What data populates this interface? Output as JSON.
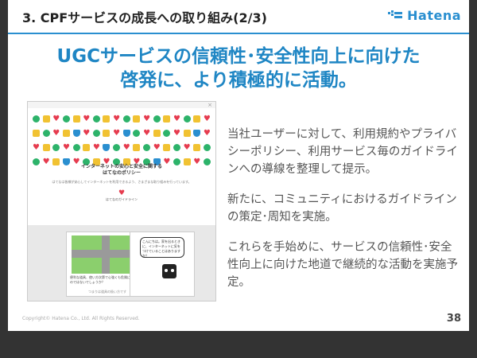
{
  "header": {
    "title": "3. CPFサービスの成長への取り組み(2/3)",
    "logo_text": "Hatena"
  },
  "heading": {
    "line1": "UGCサービスの信頼性･安全性向上に向けた",
    "line2": "啓発に、より積極的に活動。"
  },
  "preview": {
    "close_glyph": "×",
    "policy_title": "インターネットの安心と安全に関する",
    "policy_subtitle": "はてなのポリシー",
    "policy_body": "はてなは皆様が安心してインターネットを利用できるよう、さまざまな取り組みを行っています。",
    "policy_link": "はてなのガイドライン",
    "left_card_caption": "便利な道具、使い方次第で心強くも危険にも変わるのではないでしょうか？",
    "left_card_footer": "つまりは道具の扱い方です",
    "right_card_bubble": "こんにちは。家を出るときに、インターネットに気をつけていることはありますか？"
  },
  "bullets": [
    "当社ユーザーに対して、利用規約やプライバシーポリシー、利用サービス毎のガイドラインへの導線を整理して提示。",
    "新たに、コミュニティにおけるガイドラインの策定･周知を実施。",
    "これらを手始めに、サービスの信頼性･安全性向上に向けた地道で継続的な活動を実施予定。"
  ],
  "footer": {
    "copyright": "Copyright© Hatena Co., Ltd. All Rights Reserved.",
    "page_number": "38"
  },
  "colors": {
    "accent": "#1f86c4",
    "check": "#2db36a",
    "heart": "#e63c4f",
    "lock": "#f1c232",
    "shield": "#2a8fd0"
  },
  "icon_rows": [
    [
      "check-icon",
      "lock-icon",
      "heart-icon",
      "check-icon",
      "lock-icon",
      "heart-icon",
      "check-icon",
      "lock-icon",
      "heart-icon",
      "check-icon",
      "lock-icon",
      "heart-icon",
      "check-icon",
      "lock-icon",
      "heart-icon",
      "check-icon",
      "lock-icon",
      "heart-icon"
    ],
    [
      "lock-icon",
      "check-icon",
      "heart-icon",
      "lock-icon",
      "shield-icon",
      "heart-icon",
      "check-icon",
      "lock-icon",
      "heart-icon",
      "shield-icon",
      "check-icon",
      "heart-icon",
      "lock-icon",
      "check-icon",
      "heart-icon",
      "lock-icon",
      "shield-icon",
      "heart-icon"
    ],
    [
      "heart-icon",
      "lock-icon",
      "check-icon",
      "heart-icon",
      "check-icon",
      "lock-icon",
      "heart-icon",
      "shield-icon",
      "check-icon",
      "heart-icon",
      "lock-icon",
      "check-icon",
      "heart-icon",
      "lock-icon",
      "check-icon",
      "heart-icon",
      "lock-icon",
      "check-icon"
    ],
    [
      "check-icon",
      "heart-icon",
      "lock-icon",
      "shield-icon",
      "heart-icon",
      "check-icon",
      "lock-icon",
      "heart-icon",
      "check-icon",
      "lock-icon",
      "heart-icon",
      "check-icon",
      "shield-icon",
      "heart-icon",
      "check-icon",
      "lock-icon",
      "heart-icon",
      "check-icon"
    ]
  ]
}
